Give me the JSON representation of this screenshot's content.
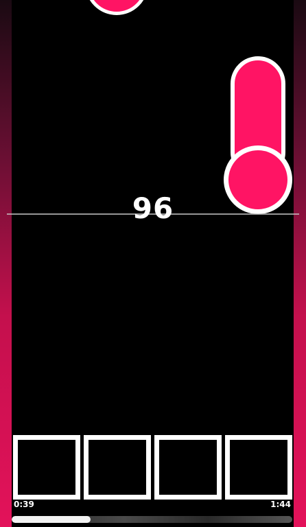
{
  "game": {
    "combo": "96",
    "accent_color": "#ff1464",
    "lane_count": 4
  },
  "notes": [
    {
      "type": "tap",
      "lane": 2,
      "state": "falling"
    },
    {
      "type": "hold",
      "lane": 4,
      "state": "at-judge-line"
    }
  ],
  "progress": {
    "elapsed": "0:39",
    "total": "1:44",
    "fraction": 0.375
  }
}
